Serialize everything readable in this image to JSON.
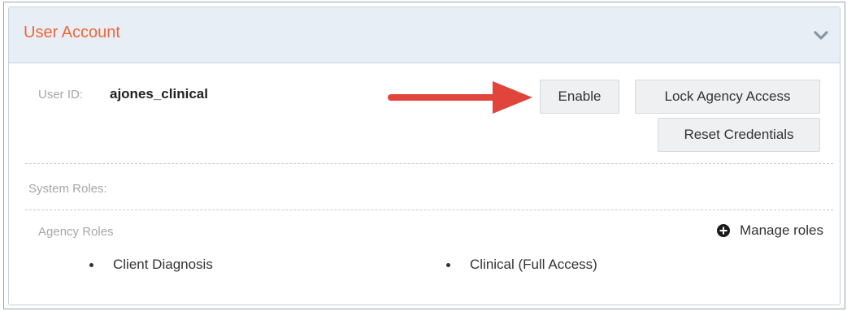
{
  "panel": {
    "title": "User Account",
    "collapse_icon": "chevron-down-icon"
  },
  "user": {
    "id_label": "User ID:",
    "id_value": "ajones_clinical"
  },
  "actions": {
    "enable_label": "Enable",
    "lock_label": "Lock Agency Access",
    "reset_label": "Reset Credentials"
  },
  "annotation": {
    "arrow_icon": "red-arrow-right-icon",
    "arrow_color": "#e0443a"
  },
  "system_roles": {
    "label": "System Roles:"
  },
  "agency_roles": {
    "label": "Agency Roles",
    "manage_label": "Manage roles",
    "manage_icon": "plus-circle-icon",
    "items": [
      "Client Diagnosis",
      "Clinical (Full Access)"
    ]
  },
  "colors": {
    "title": "#f0663a",
    "header_bg": "#e8eef5"
  }
}
